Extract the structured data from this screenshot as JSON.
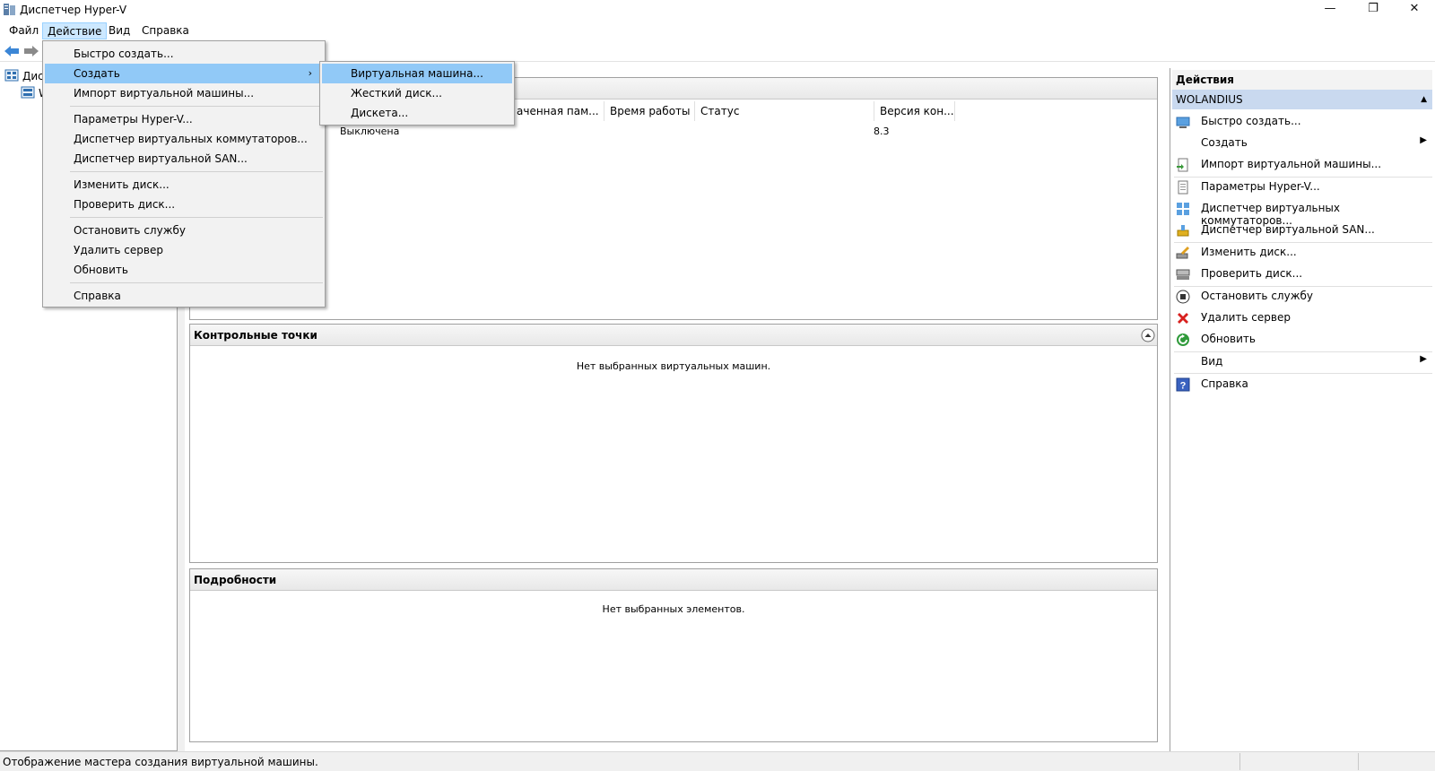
{
  "window": {
    "title": "Диспетчер Hyper-V",
    "minimize": "—",
    "restore": "❐",
    "close": "✕"
  },
  "menubar": {
    "items": [
      "Файл",
      "Действие",
      "Вид",
      "Справка"
    ]
  },
  "tree": {
    "root": "Дис",
    "server": "W"
  },
  "vm_panel": {
    "columns": [
      "аченная пам...",
      "Время работы",
      "Статус",
      "Версия кон..."
    ],
    "row": {
      "state": "Выключена",
      "version": "8.3"
    }
  },
  "checkpoints": {
    "title": "Контрольные точки",
    "empty": "Нет выбранных виртуальных машин."
  },
  "details": {
    "title": "Подробности",
    "empty": "Нет выбранных элементов."
  },
  "actions": {
    "title": "Действия",
    "server": "WOLANDIUS",
    "items": [
      {
        "label": "Быстро создать...",
        "icon": "quick-create-icon"
      },
      {
        "label": "Создать",
        "icon": "none",
        "submenu": true
      },
      {
        "label": "Импорт виртуальной машины...",
        "icon": "import-icon"
      },
      {
        "label": "Параметры Hyper-V...",
        "icon": "settings-icon"
      },
      {
        "label": "Диспетчер виртуальных коммутаторов...",
        "icon": "switch-manager-icon"
      },
      {
        "label": "Диспетчер виртуальной SAN...",
        "icon": "san-manager-icon"
      },
      {
        "label": "Изменить диск...",
        "icon": "edit-disk-icon"
      },
      {
        "label": "Проверить диск...",
        "icon": "inspect-disk-icon"
      },
      {
        "label": "Остановить службу",
        "icon": "stop-icon"
      },
      {
        "label": "Удалить сервер",
        "icon": "remove-icon"
      },
      {
        "label": "Обновить",
        "icon": "refresh-icon"
      },
      {
        "label": "Вид",
        "icon": "none",
        "submenu": true
      },
      {
        "label": "Справка",
        "icon": "help-icon"
      }
    ]
  },
  "dropdown": {
    "items": [
      "Быстро создать...",
      "Создать",
      "Импорт виртуальной машины...",
      "Параметры Hyper-V...",
      "Диспетчер виртуальных коммутаторов...",
      "Диспетчер виртуальной SAN...",
      "Изменить диск...",
      "Проверить диск...",
      "Остановить службу",
      "Удалить сервер",
      "Обновить",
      "Справка"
    ],
    "submenu_arrow": "›"
  },
  "submenu": {
    "items": [
      "Виртуальная машина...",
      "Жесткий диск...",
      "Дискета..."
    ]
  },
  "status": {
    "text": "Отображение мастера создания виртуальной машины."
  },
  "colors": {
    "highlight": "#91c9f7",
    "server_band": "#c9d9ef",
    "menu_active": "#cce8ff"
  }
}
